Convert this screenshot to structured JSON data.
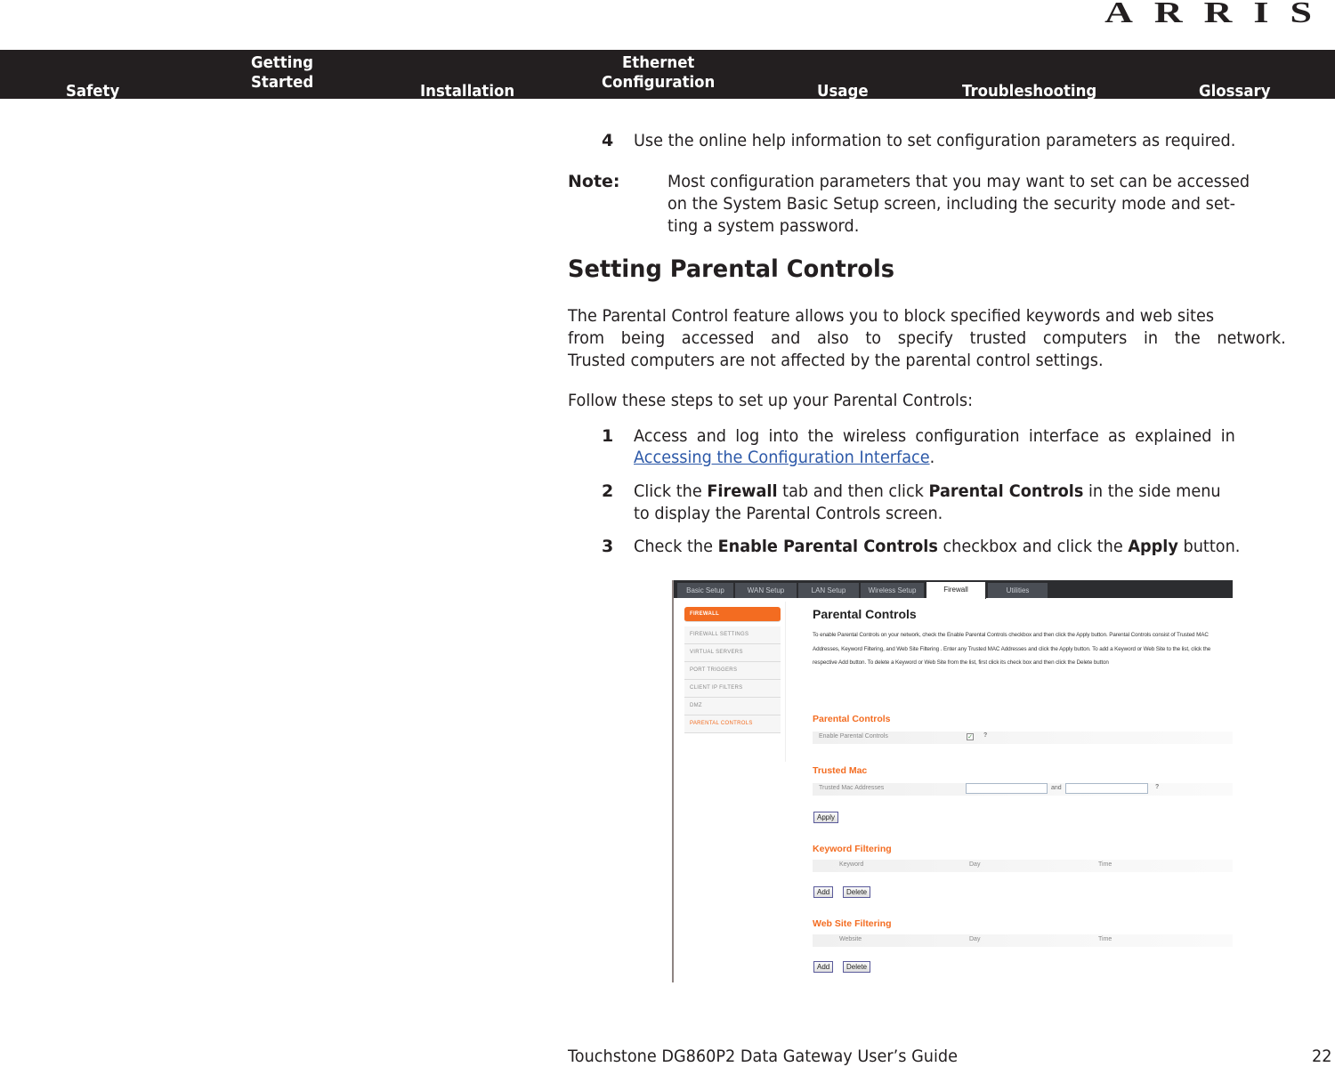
{
  "brand": {
    "logo": "ARRIS"
  },
  "nav": {
    "items": [
      {
        "line1": "",
        "line2": "Safety"
      },
      {
        "line1": "Getting",
        "line2": "Started"
      },
      {
        "line1": "",
        "line2": "Installation"
      },
      {
        "line1": "Ethernet",
        "line2": "Configuration"
      },
      {
        "line1": "",
        "line2": "Usage"
      },
      {
        "line1": "",
        "line2": "Troubleshooting"
      },
      {
        "line1": "",
        "line2": "Glossary"
      }
    ]
  },
  "content": {
    "step4": {
      "number": "4",
      "text": "Use the online help information to set configuration parameters as required."
    },
    "note": {
      "label": "Note:",
      "line1": "Most configuration parameters that you may want to set can be accessed",
      "line2": "on the System Basic Setup screen, including the security mode and set-",
      "line3": "ting a system password."
    },
    "heading": "Setting Parental Controls",
    "intro": {
      "line1": "The Parental Control feature allows you to block specified keywords and web sites",
      "line2": "from being accessed and also to specify trusted computers in the network.",
      "line3": "Trusted computers are not affected by the parental control settings."
    },
    "follow": "Follow these steps to set up your Parental Controls:",
    "steps": [
      {
        "number": "1",
        "line1": "Access and log into the wireless configuration interface as explained in",
        "link": "Accessing the Configuration Interface",
        "after_link": "."
      },
      {
        "number": "2",
        "pre": "Click the ",
        "b1": "Firewall",
        "mid": " tab and then click ",
        "b2": "Parental Controls",
        "post": " in the side menu",
        "line2": "to display the Parental Controls screen."
      },
      {
        "number": "3",
        "pre": "Check the ",
        "b1": "Enable Parental Controls",
        "mid": " checkbox and click the ",
        "b2": "Apply",
        "post": " button."
      }
    ]
  },
  "screenshot": {
    "tabs": [
      "Basic Setup",
      "WAN Setup",
      "LAN Setup",
      "Wireless Setup",
      "Firewall",
      "Utilities"
    ],
    "active_tab": "Firewall",
    "side_menu": [
      "FIREWALL",
      "FIREWALL SETTINGS",
      "VIRTUAL SERVERS",
      "PORT TRIGGERS",
      "CLIENT IP FILTERS",
      "DMZ",
      "PARENTAL CONTROLS"
    ],
    "title": "Parental Controls",
    "description": "To enable Parental Controls on your network, check the Enable Parental Controls checkbox and then click the Apply button. Parental Controls consist of Trusted MAC Addresses, Keyword Filtering, and Web Site Filtering . Enter any Trusted MAC Addresses and click the Apply button. To add a Keyword or Web Site to the list, click the respective Add button. To delete a Keyword or Web Site from the list, first click its check box and then click the Delete button",
    "sections": {
      "parental": {
        "title": "Parental Controls",
        "label": "Enable Parental Controls",
        "checked": true,
        "help": "?"
      },
      "trusted": {
        "title": "Trusted Mac",
        "label": "Trusted Mac Addresses",
        "and": "and",
        "input1": "",
        "input2": "",
        "help": "?",
        "apply": "Apply"
      },
      "keyword": {
        "title": "Keyword Filtering",
        "columns": [
          "Keyword",
          "Day",
          "Time"
        ],
        "add": "Add",
        "delete": "Delete"
      },
      "website": {
        "title": "Web Site Filtering",
        "columns": [
          "Website",
          "Day",
          "Time"
        ],
        "add": "Add",
        "delete": "Delete"
      }
    }
  },
  "footer": {
    "title": "Touchstone DG860P2 Data Gateway User’s Guide",
    "page": "22"
  }
}
